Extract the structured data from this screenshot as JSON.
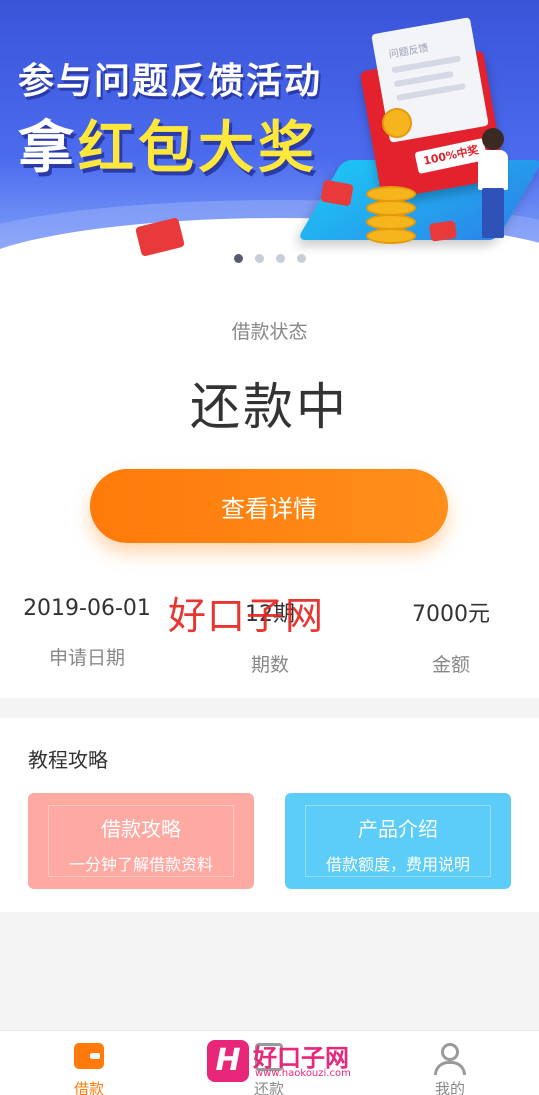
{
  "banner": {
    "title_line1": "参与问题反馈活动",
    "title_line2_prefix": "拿",
    "title_line2_highlight": "红包大奖",
    "badge_text": "100%中奖",
    "letter_heading": "问题反馈",
    "carousel_dots": 4,
    "active_dot": 0
  },
  "status": {
    "label": "借款状态",
    "value": "还款中",
    "button_label": "查看详情"
  },
  "stats": [
    {
      "value": "2019-06-01",
      "label": "申请日期"
    },
    {
      "value": "12期",
      "label": "期数"
    },
    {
      "value": "7000元",
      "label": "金额"
    }
  ],
  "watermark": {
    "overlay_text": "好口子网",
    "logo_letter": "H",
    "logo_name": "好口子网",
    "logo_url": "www.haokouzi.com"
  },
  "tutorial": {
    "title": "教程攻略",
    "cards": [
      {
        "title": "借款攻略",
        "subtitle": "一分钟了解借款资料",
        "color": "#ffa9a3"
      },
      {
        "title": "产品介绍",
        "subtitle": "借款额度，费用说明",
        "color": "#5ccdf8"
      }
    ]
  },
  "tabbar": {
    "items": [
      {
        "label": "借款",
        "icon": "wallet-icon",
        "active": true
      },
      {
        "label": "还款",
        "icon": "repay-icon",
        "active": false
      },
      {
        "label": "我的",
        "icon": "user-icon",
        "active": false
      }
    ]
  },
  "colors": {
    "accent": "#ff7a0a",
    "banner_blue": "#3a54d8",
    "card_pink": "#ffa9a3",
    "card_blue": "#5ccdf8"
  }
}
